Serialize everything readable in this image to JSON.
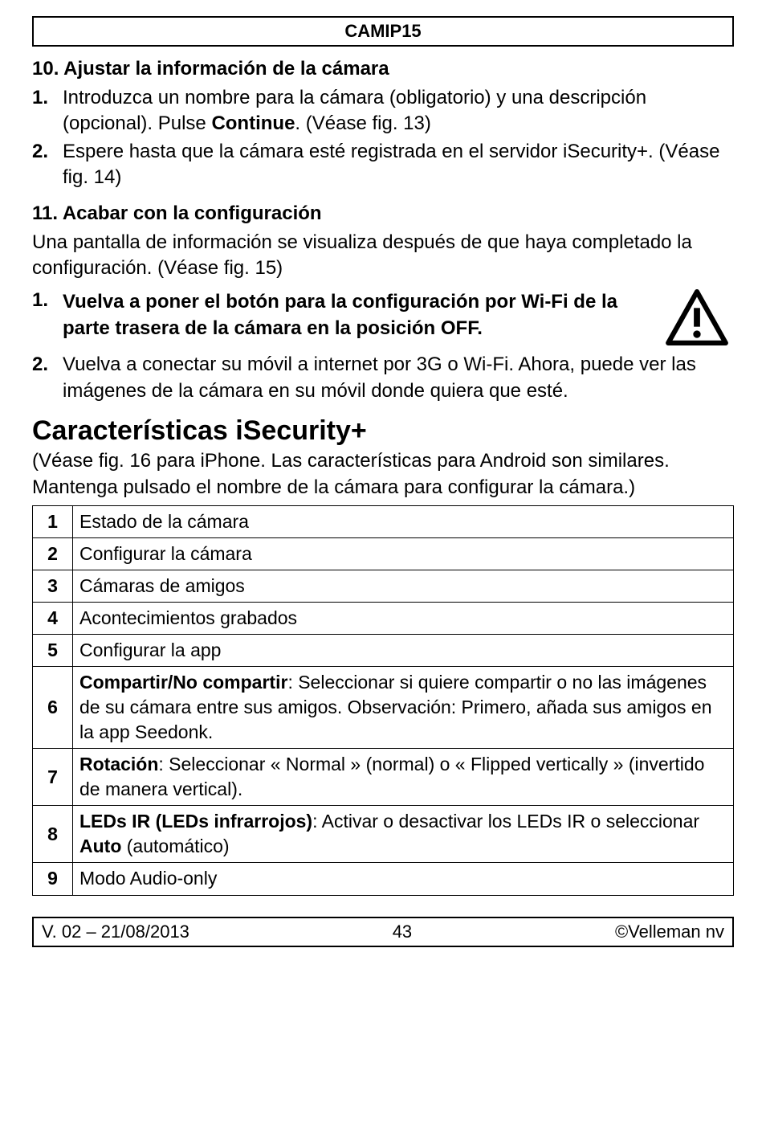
{
  "header": "CAMIP15",
  "section10": {
    "title": "10. Ajustar la información de la cámara",
    "items": [
      {
        "num": "1.",
        "pre": "Introduzca un nombre para la cámara (obligatorio) y una descripción (opcional). Pulse ",
        "bold": "Continue",
        "post": ". (Véase fig. 13)"
      },
      {
        "num": "2.",
        "pre": "Espere hasta que la cámara esté registrada en el servidor iSecurity+. (Véase fig. 14)",
        "bold": "",
        "post": ""
      }
    ]
  },
  "section11": {
    "title": "11. Acabar con la configuración",
    "intro": "Una pantalla de información se visualiza después de que haya completado la configuración. (Véase fig. 15)",
    "item1": {
      "num": "1.",
      "text": "Vuelva a poner el botón para la configuración por Wi-Fi de la parte trasera de la cámara en la posición OFF."
    },
    "item2": {
      "num": "2.",
      "text": "Vuelva a conectar su móvil a internet por 3G o Wi-Fi. Ahora, puede ver las imágenes de la cámara en su móvil donde quiera que esté."
    }
  },
  "features_title": "Características iSecurity+",
  "features_intro": "(Véase fig. 16 para iPhone. Las características para Android son similares. Mantenga pulsado el nombre de la cámara para configurar la cámara.)",
  "rows": [
    {
      "n": "1",
      "bold": "",
      "rest": "Estado de la cámara"
    },
    {
      "n": "2",
      "bold": "",
      "rest": "Configurar la cámara"
    },
    {
      "n": "3",
      "bold": "",
      "rest": "Cámaras de amigos"
    },
    {
      "n": "4",
      "bold": "",
      "rest": "Acontecimientos grabados"
    },
    {
      "n": "5",
      "bold": "",
      "rest": "Configurar la app"
    },
    {
      "n": "6",
      "bold": "Compartir/No compartir",
      "rest": ": Seleccionar si quiere compartir o no las imágenes de su cámara entre sus amigos. Observación: Primero, añada sus amigos en la app Seedonk."
    },
    {
      "n": "7",
      "bold": "Rotación",
      "rest": ": Seleccionar « Normal » (normal) o « Flipped vertically » (invertido de manera vertical)."
    }
  ],
  "row8": {
    "n": "8",
    "b1": "LEDs IR (LEDs infrarrojos)",
    "mid": ": Activar o desactivar los LEDs IR o seleccionar ",
    "b2": "Auto",
    "post": " (automático)"
  },
  "row9": {
    "n": "9",
    "rest": "Modo Audio-only"
  },
  "footer": {
    "left": "V. 02 – 21/08/2013",
    "center": "43",
    "right": "©Velleman nv"
  }
}
